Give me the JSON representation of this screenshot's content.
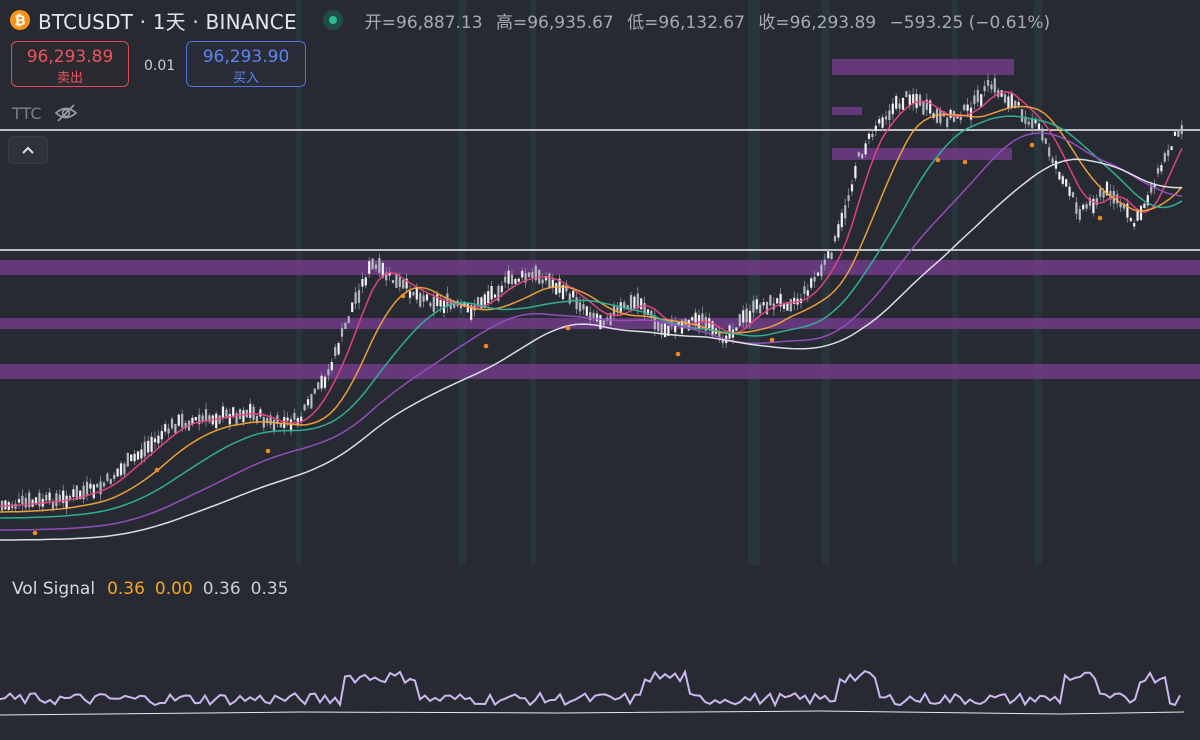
{
  "header": {
    "symbol": "BTCUSDT",
    "timeframe": "1天",
    "exchange": "BINANCE",
    "title": "BTCUSDT · 1天 · BINANCE",
    "coin_icon": "bitcoin-icon",
    "ohlc": [
      {
        "label": "开",
        "value": "96,887.13"
      },
      {
        "label": "高",
        "value": "96,935.67"
      },
      {
        "label": "低",
        "value": "96,132.67"
      },
      {
        "label": "收",
        "value": "96,293.89"
      }
    ],
    "change": "−593.25 (−0.61%)"
  },
  "trade": {
    "sell_price": "96,293.89",
    "sell_label": "卖出",
    "spread": "0.01",
    "buy_price": "96,293.90",
    "buy_label": "买入"
  },
  "indicator": {
    "name": "TTC",
    "visibility_icon": "eye-off-icon"
  },
  "volume_pane": {
    "label": "Vol Signal",
    "values": [
      "0.36",
      "0.00",
      "0.36",
      "0.35"
    ],
    "colors": [
      "#f5a623",
      "#f5a623",
      "#c9ccd3",
      "#c9ccd3"
    ]
  },
  "colors": {
    "background": "#272a33",
    "zone": "#7a3d93",
    "ema_fast": "#e8457f",
    "ema_mid": "#f3a43a",
    "ema_slow": "#2fb597",
    "ema_long": "#9a4fc0",
    "ema_base": "#e6e6f0",
    "vol_line": "#cdb8ee"
  }
}
